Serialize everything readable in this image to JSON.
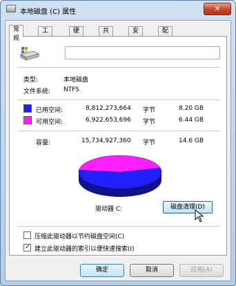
{
  "window": {
    "title": "本地磁盘 (C) 属性",
    "close_label": "✕"
  },
  "tabs": [
    {
      "label": "常规",
      "active": true
    },
    {
      "label": "工具",
      "active": false
    },
    {
      "label": "硬件",
      "active": false
    },
    {
      "label": "共享",
      "active": false
    },
    {
      "label": "安全",
      "active": false
    },
    {
      "label": "配额",
      "active": false
    }
  ],
  "general": {
    "drive_name_value": "",
    "type_label": "类型:",
    "type_value": "本地磁盘",
    "fs_label": "文件系统:",
    "fs_value": "NTFS",
    "used": {
      "label": "已用空间:",
      "bytes": "8,812,273,664",
      "unit": "字节",
      "size": "8.20 GB",
      "color": "#1f1fff"
    },
    "free": {
      "label": "可用空间:",
      "bytes": "6,922,653,696",
      "unit": "字节",
      "size": "6.44 GB",
      "color": "#ff1fff"
    },
    "capacity": {
      "label": "容量:",
      "bytes": "15,734,927,360",
      "unit": "字节",
      "size": "14.6 GB"
    },
    "drive_label": "驱动器 C:",
    "cleanup_button": "磁盘清理(D)",
    "compress_label": "压缩此驱动器以节约磁盘空间(C)",
    "compress_checked": false,
    "index_label": "建立此驱动器的索引以便快速搜索(I)",
    "index_checked": true
  },
  "buttons": {
    "ok": "确定",
    "cancel": "取消",
    "apply": "应用(A)"
  },
  "chart_data": {
    "type": "pie",
    "categories": [
      "已用空间",
      "可用空间"
    ],
    "values": [
      8812273664,
      6922653696
    ],
    "colors": [
      "#1f1fff",
      "#ff1fff"
    ]
  }
}
